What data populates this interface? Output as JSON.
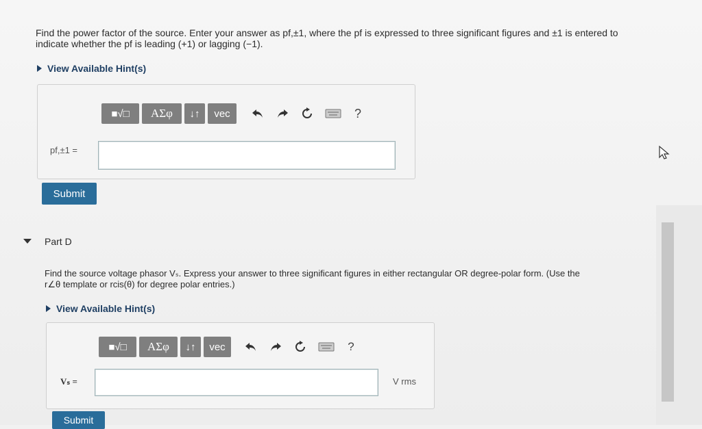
{
  "partC": {
    "question_line1": "Find the power factor of the source.  Enter your answer as pf,±1, where the pf is expressed to three significant figures and ±1 is entered to",
    "question_line2": "indicate whether the pf is leading (+1) or lagging (−1).",
    "hint_label": "View Available Hint(s)",
    "input_label": "pf,±1 =",
    "input_value": "",
    "submit_label": "Submit"
  },
  "toolbar": {
    "templates_label": "■√□",
    "greek_label": "ΑΣφ",
    "arrows_label": "↓↑",
    "vec_label": "vec",
    "help_label": "?"
  },
  "partD": {
    "title": "Part D",
    "question_line1": "Find the source voltage phasor Vₛ.  Express your answer to three significant figures in either rectangular OR degree-polar form. (Use the",
    "question_line2": "r∠θ template or rcis(θ) for degree polar entries.)",
    "hint_label": "View Available Hint(s)",
    "input_label": "Vₛ =",
    "input_value": "",
    "units": "V rms",
    "submit_label": "Submit"
  },
  "icons": [
    "undo-icon",
    "redo-icon",
    "reset-icon",
    "keyboard-icon",
    "help-icon",
    "cursor-icon"
  ]
}
